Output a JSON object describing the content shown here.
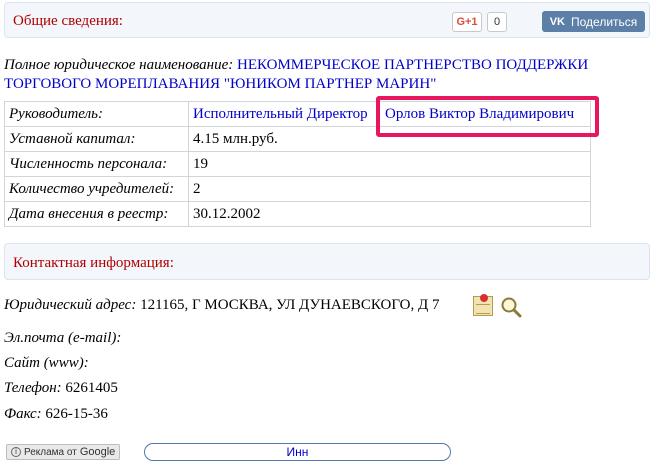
{
  "general": {
    "title": "Общие сведения:",
    "gplus_label": "G+1",
    "gplus_count": "0",
    "vk_logo": "VK",
    "vk_label": "Поделиться"
  },
  "full_name": {
    "label": "Полное юридическое наименование:",
    "value": "НЕКОММЕРЧЕСКОЕ ПАРТНЕРСТВО ПОДДЕРЖКИ ТОРГОВОГО МОРЕПЛАВАНИЯ \"ЮНИКОМ ПАРТНЕР МАРИН\""
  },
  "info_table": {
    "rows": [
      {
        "key": "Руководитель:",
        "role": "Исполнительный Директор",
        "person": "Орлов Виктор Владимирович"
      },
      {
        "key": "Уставной капитал:",
        "value": "4.15 млн.руб."
      },
      {
        "key": "Численность персонала:",
        "value": "19"
      },
      {
        "key": "Количество учредителей:",
        "value": "2"
      },
      {
        "key": "Дата внесения в реестр:",
        "value": "30.12.2002"
      }
    ]
  },
  "contacts": {
    "title": "Контактная информация:",
    "address_label": "Юридический адрес:",
    "address_value": "121165, Г МОСКВА, УЛ ДУНАЕВСКОГО, Д 7",
    "email_label": "Эл.почта (e-mail):",
    "site_label": "Сайт (www):",
    "phone_label": "Телефон:",
    "phone_value": "6261405",
    "fax_label": "Факс:",
    "fax_value": "626-15-36"
  },
  "footer": {
    "ad_info": "i",
    "ad_prefix": "Реклама от",
    "ad_brand": "Google",
    "inn_label": "Инн"
  },
  "colors": {
    "header_title": "#b00000",
    "link": "#0000cc",
    "highlight": "#e8175d",
    "vk": "#5b7fa6"
  },
  "icons": [
    "map-icon",
    "search-icon",
    "info-icon"
  ]
}
